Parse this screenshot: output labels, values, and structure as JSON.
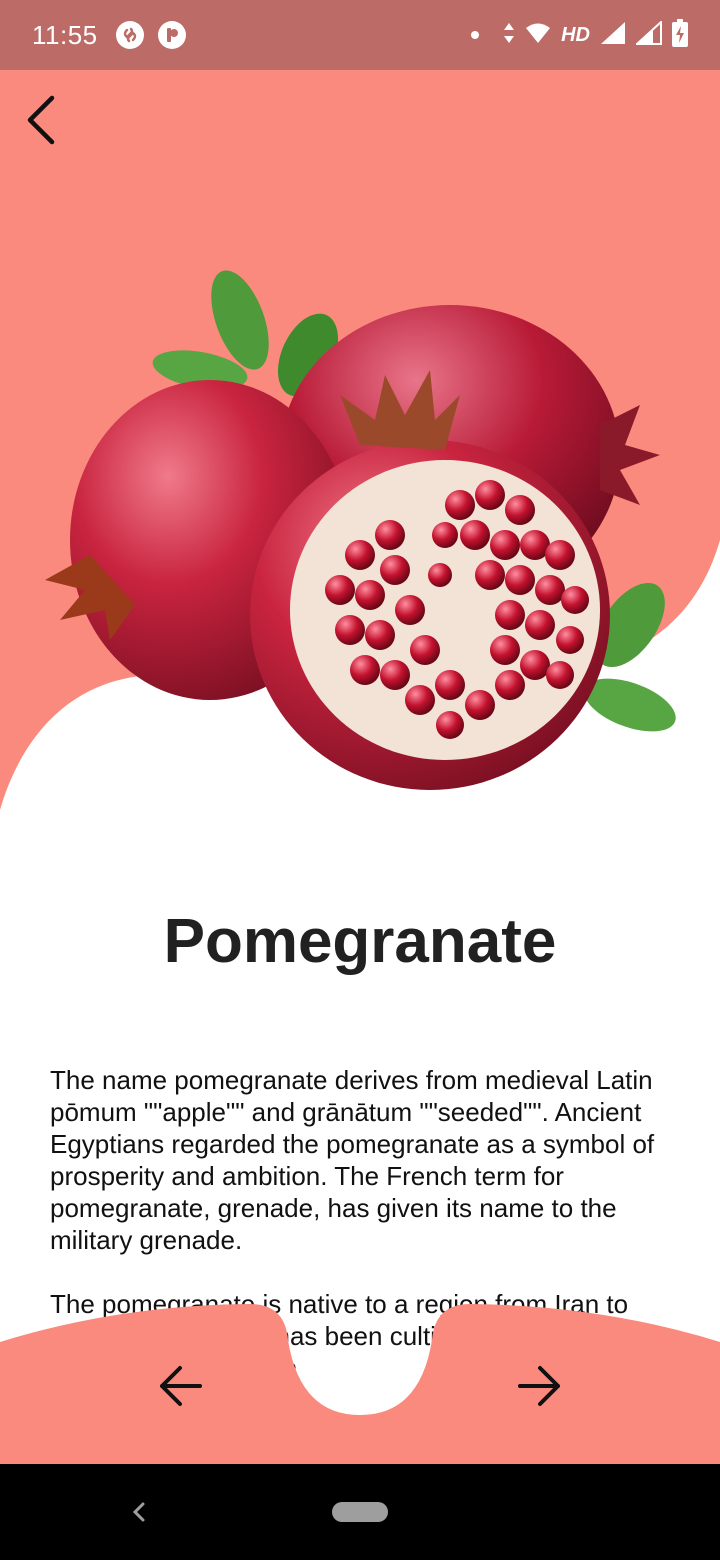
{
  "status_bar": {
    "time": "11:55",
    "network_label": "HD",
    "icons": [
      "shazam-icon",
      "profile-icon",
      "dot-icon",
      "data-arrows-icon",
      "wifi-icon",
      "signal-icon",
      "signal-icon",
      "battery-charging-icon"
    ]
  },
  "header": {
    "back_icon": "chevron-left-icon",
    "background_color": "#fb8a7e"
  },
  "fruit": {
    "name": "Pomegranate",
    "image_icon": "pomegranate-image",
    "description": [
      "The name pomegranate derives from medieval Latin pōmum \"\"apple\"\" and grānātum \"\"seeded\"\". Ancient Egyptians regarded the pomegranate as a symbol of prosperity and ambition. The French term for pomegranate, grenade, has given its name to the military grenade.",
      "The pomegranate is native to a region from Iran to northern India, and has been cultivated throughout the Mediterranean region"
    ]
  },
  "bottom_nav": {
    "prev_icon": "arrow-left-icon",
    "next_icon": "arrow-right-icon",
    "background_color": "#fb8a7e"
  },
  "system_nav": {
    "back_icon": "system-back-icon",
    "home_icon": "system-home-pill-icon"
  }
}
